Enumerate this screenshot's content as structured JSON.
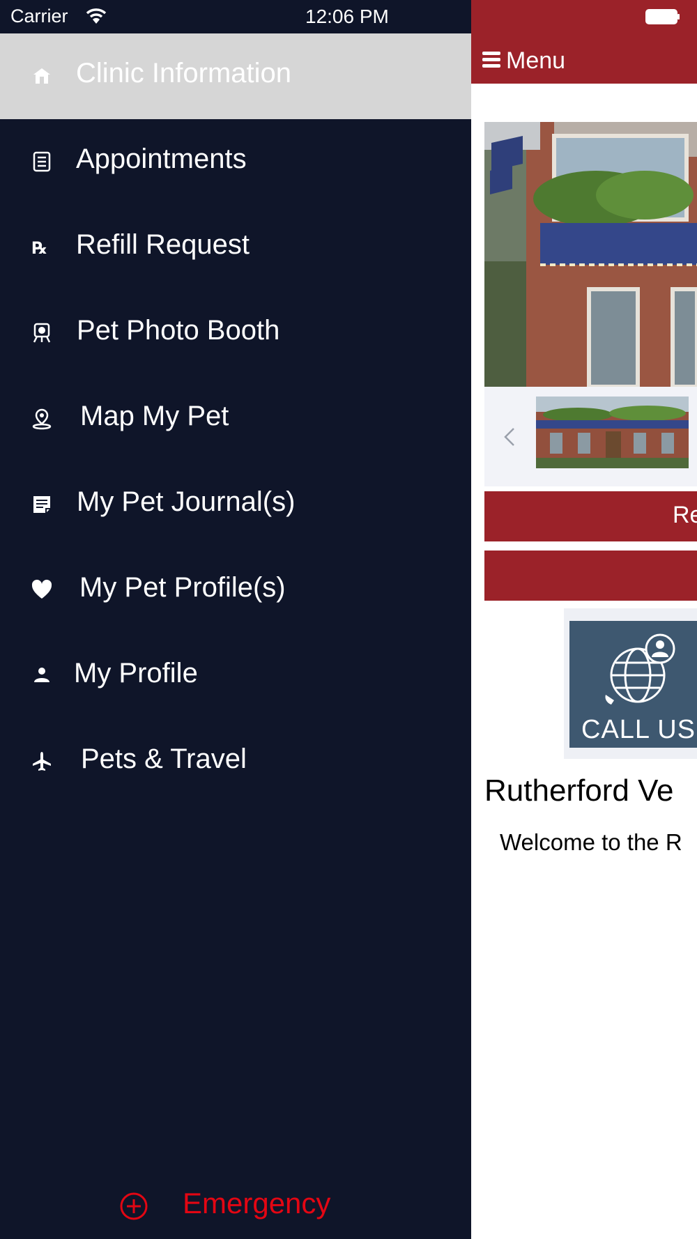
{
  "status_bar": {
    "carrier": "Carrier",
    "time": "12:06 PM"
  },
  "drawer": {
    "items": [
      {
        "label": "Clinic Information",
        "icon": "house-icon",
        "selected": true
      },
      {
        "label": "Appointments",
        "icon": "list-icon"
      },
      {
        "label": "Refill Request",
        "icon": "rx-icon"
      },
      {
        "label": "Pet Photo Booth",
        "icon": "camera-icon"
      },
      {
        "label": "Map My Pet",
        "icon": "map-pin-icon"
      },
      {
        "label": "My Pet Journal(s)",
        "icon": "journal-icon"
      },
      {
        "label": "My Pet Profile(s)",
        "icon": "heart-icon"
      },
      {
        "label": "My Profile",
        "icon": "person-icon"
      },
      {
        "label": "Pets & Travel",
        "icon": "airplane-icon"
      }
    ],
    "emergency": {
      "label": "Emergency",
      "icon": "plus-circle-icon"
    }
  },
  "main": {
    "header": {
      "menu_label": "Menu"
    },
    "buttons": [
      {
        "label": "Re"
      },
      {
        "label": ""
      }
    ],
    "call_card": {
      "label": "CALL US"
    },
    "clinic_name": "Rutherford Ve",
    "welcome_text": "Welcome to the R"
  },
  "colors": {
    "drawer_background": "#0f1529",
    "selected_item_background": "#d6d6d6",
    "brand_red": "#9b2229",
    "emergency_red": "#e30613",
    "call_card_blue": "#3e5870"
  }
}
